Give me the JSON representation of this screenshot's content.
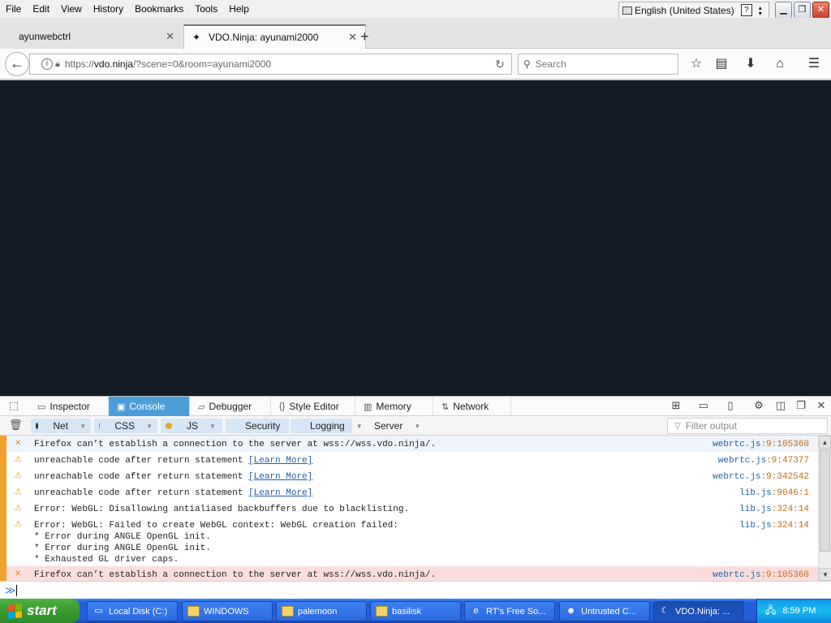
{
  "menubar": {
    "items": [
      "File",
      "Edit",
      "View",
      "History",
      "Bookmarks",
      "Tools",
      "Help"
    ],
    "language": "English (United States)"
  },
  "tabs": [
    {
      "title": "ayunwebctrl",
      "active": false
    },
    {
      "title": "VDO.Ninja: ayunami2000",
      "active": true
    }
  ],
  "navbar": {
    "url_prefix": "https://",
    "url_host": "vdo.ninja",
    "url_rest": "/?scene=0&room=ayunami2000",
    "search_placeholder": "Search"
  },
  "devtools": {
    "tabs": [
      "Inspector",
      "Console",
      "Debugger",
      "Style Editor",
      "Memory",
      "Network"
    ],
    "active_tab": "Console",
    "filters": [
      {
        "label": "Net",
        "color": "#333333",
        "on": true
      },
      {
        "label": "CSS",
        "color": "#3aa0e0",
        "on": true
      },
      {
        "label": "JS",
        "color": "#f0a12e",
        "on": true
      },
      {
        "label": "Security",
        "color": "#d33b3b",
        "on": true
      },
      {
        "label": "Logging",
        "color": "#999999",
        "on": true
      },
      {
        "label": "Server",
        "color": "#5aaa4a",
        "on": false
      }
    ],
    "filter_placeholder": "Filter output",
    "messages": [
      {
        "type": "error",
        "text": "Firefox can’t establish a connection to the server at wss://wss.vdo.ninja/.",
        "file": "webrtc.js",
        "loc": ":9:105360"
      },
      {
        "type": "warn",
        "text": "unreachable code after return statement ",
        "link": "[Learn More]",
        "file": "webrtc.js",
        "loc": ":9:47377"
      },
      {
        "type": "warn",
        "text": "unreachable code after return statement ",
        "link": "[Learn More]",
        "file": "webrtc.js",
        "loc": ":9:342542"
      },
      {
        "type": "warn",
        "text": "unreachable code after return statement ",
        "link": "[Learn More]",
        "file": "lib.js",
        "loc": ":9046:1"
      },
      {
        "type": "warn",
        "text": "Error: WebGL: Disallowing antialiased backbuffers due to blacklisting.",
        "file": "lib.js",
        "loc": ":324:14"
      },
      {
        "type": "warn",
        "text": "Error: WebGL: Failed to create WebGL context: WebGL creation failed:\n* Error during ANGLE OpenGL init.\n* Error during ANGLE OpenGL init.\n* Exhausted GL driver caps.",
        "file": "lib.js",
        "loc": ":324:14"
      },
      {
        "type": "error",
        "text": "Firefox can’t establish a connection to the server at wss://wss.vdo.ninja/.",
        "file": "webrtc.js",
        "loc": ":9:105360"
      }
    ]
  },
  "taskbar": {
    "start_label": "start",
    "buttons": [
      {
        "label": "Local Disk (C:)",
        "icon": "drive-icon"
      },
      {
        "label": "WINDOWS",
        "icon": "folder-icon"
      },
      {
        "label": "palemoon",
        "icon": "folder-icon"
      },
      {
        "label": "basilisk",
        "icon": "folder-icon"
      },
      {
        "label": "RT's Free So...",
        "icon": "ie-icon"
      },
      {
        "label": "Untrusted C...",
        "icon": "raccoon-icon"
      },
      {
        "label": "VDO.Ninja: ...",
        "icon": "palemoon-icon"
      }
    ],
    "clock": "8:59 PM"
  }
}
